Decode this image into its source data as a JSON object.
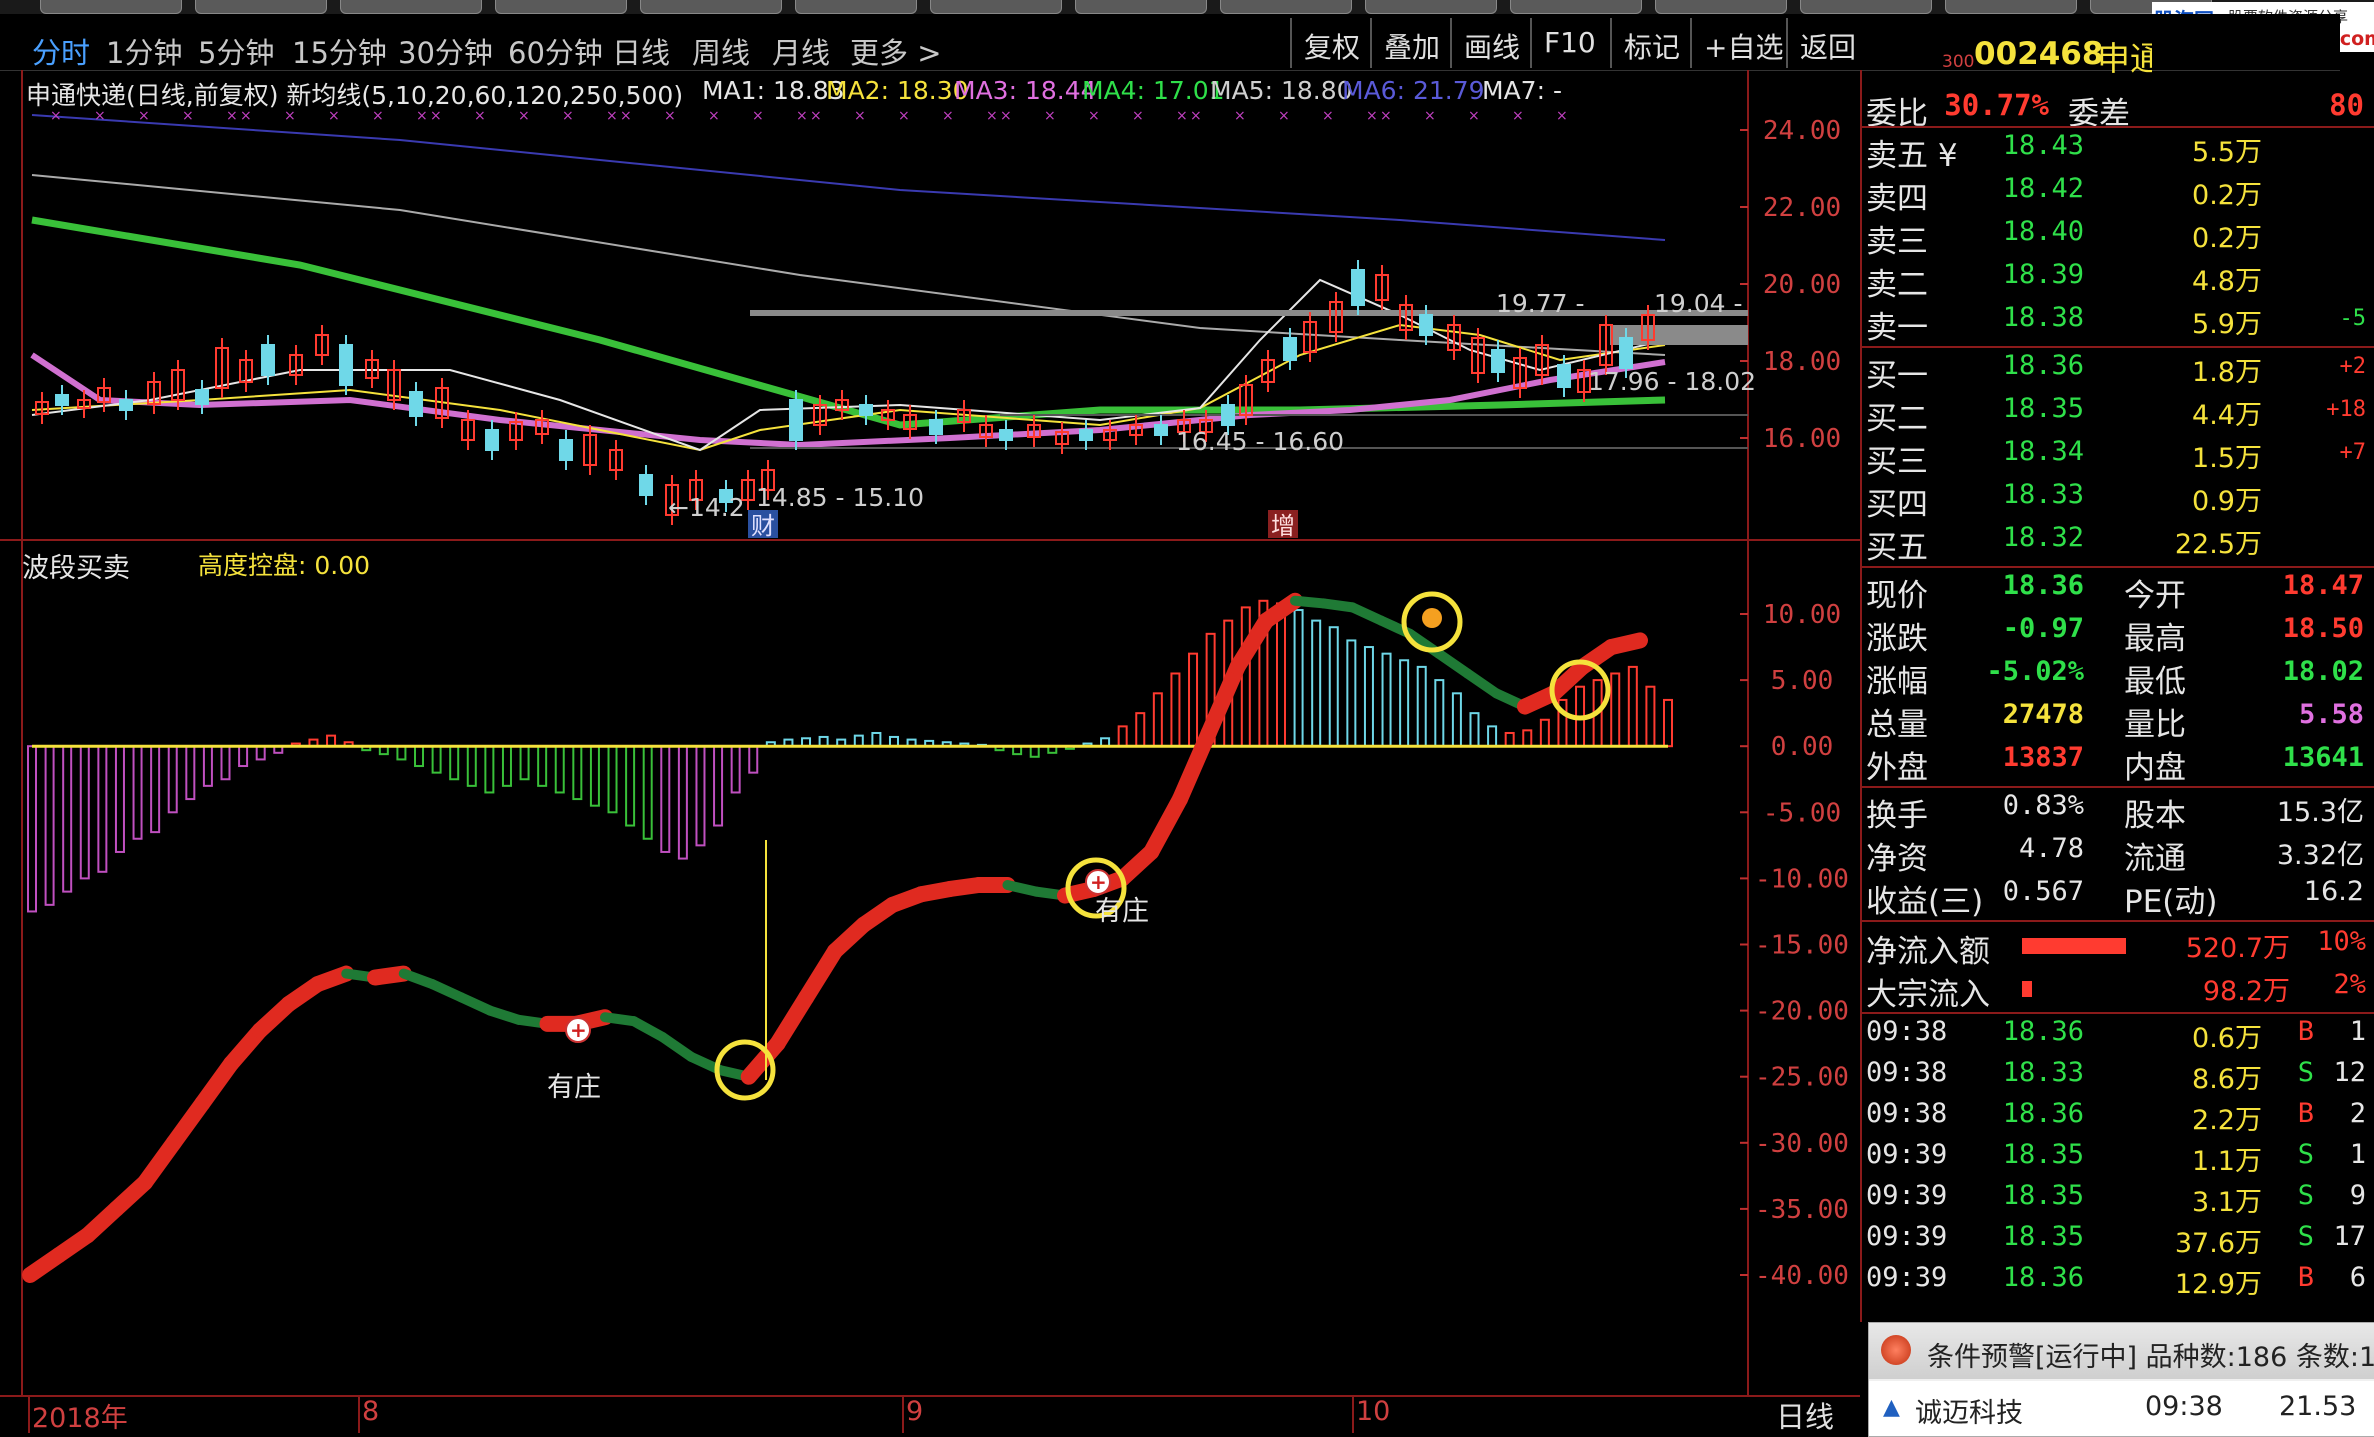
{
  "period_bar": {
    "items": [
      "分时",
      "1分钟",
      "5分钟",
      "15分钟",
      "30分钟",
      "60分钟",
      "日线",
      "周线",
      "月线",
      "更多 >"
    ],
    "active_index": 0,
    "tools": [
      "复权",
      "叠加",
      "画线",
      "F10",
      "标记",
      "+自选",
      "返回"
    ]
  },
  "watermark": {
    "site": "股海网",
    "slogan": "股票软件资源分享",
    "url": "www.Guhai.com.cn"
  },
  "stock": {
    "prefix": "300",
    "code": "002468",
    "name": "申通快递"
  },
  "main_chart": {
    "title": "申通快递(日线,前复权) 新均线(5,10,20,60,120,250,500)",
    "ma": [
      {
        "label": "MA1: 18.83",
        "color": "#e6e6e6"
      },
      {
        "label": "MA2: 18.30",
        "color": "#f5e23c"
      },
      {
        "label": "MA3: 18.44",
        "color": "#e070e0"
      },
      {
        "label": "MA4: 17.01",
        "color": "#2fe04a"
      },
      {
        "label": "MA5: 18.80",
        "color": "#cfcfcf"
      },
      {
        "label": "MA6: 21.79",
        "color": "#5a5ad8"
      },
      {
        "label": "MA7: -",
        "color": "#e6e6e6"
      }
    ],
    "y_axis": [
      "24.00",
      "22.00",
      "20.00",
      "18.00",
      "16.00"
    ],
    "annotations": {
      "high_range": "19.77 -",
      "high_right": "19.04 -",
      "low_right": "17.96 - 18.02",
      "mid_range": "16.45 - 16.60",
      "low_label": "←14.2",
      "low_range": "14.85 - 15.10",
      "badge_cai": "财",
      "badge_zeng": "增"
    }
  },
  "sub_chart": {
    "title": "波段买卖",
    "control_label": "高度控盘: 0.00",
    "y_axis": [
      "10.00",
      "5.00",
      "0.00",
      "-5.00",
      "-10.00",
      "-15.00",
      "-20.00",
      "-25.00",
      "-30.00",
      "-35.00",
      "-40.00"
    ],
    "labels": [
      "有庄",
      "有庄"
    ]
  },
  "chart_data": {
    "type": "bar",
    "title": "波段买卖",
    "ylim": [
      -42,
      12
    ],
    "values": [
      -12.5,
      -12,
      -11,
      -10,
      -9.5,
      -8,
      -7,
      -6.5,
      -5,
      -4,
      -3,
      -2.5,
      -1.5,
      -1,
      -0.5,
      0.2,
      0.5,
      0.8,
      0.3,
      -0.3,
      -0.6,
      -1,
      -1.5,
      -2,
      -2.5,
      -3,
      -3.5,
      -3,
      -2.5,
      -3,
      -3.5,
      -4,
      -4.5,
      -5,
      -6,
      -7,
      -8,
      -8.5,
      -7.5,
      -6,
      -3.5,
      -2,
      0.3,
      0.5,
      0.6,
      0.7,
      0.5,
      0.8,
      1,
      0.7,
      0.5,
      0.4,
      0.3,
      0.2,
      0.1,
      -0.3,
      -0.6,
      -0.8,
      -0.5,
      -0.2,
      0.2,
      0.6,
      1.5,
      2.5,
      4,
      5.5,
      7,
      8.5,
      9.5,
      10.5,
      11,
      10.8,
      10.3,
      9.5,
      9,
      8,
      7.5,
      7,
      6.5,
      6,
      5,
      4,
      2.5,
      1.5,
      1,
      1.2,
      2,
      3.5,
      4.5,
      5,
      5.5,
      6,
      4.5,
      3.5
    ],
    "wave_line": [
      -40,
      -38.5,
      -37,
      -35,
      -33,
      -30,
      -27,
      -24,
      -21.5,
      -19.5,
      -18,
      -17.2,
      -17.5,
      -17.2,
      -18,
      -19,
      -20,
      -20.7,
      -21,
      -21,
      -20.5,
      -20.8,
      -22,
      -23.5,
      -24.5,
      -25,
      -22.5,
      -19,
      -15.5,
      -13.5,
      -12,
      -11.2,
      -10.8,
      -10.5,
      -10.5,
      -11,
      -11.3,
      -10.8,
      -10,
      -8,
      -4,
      1,
      6,
      9.5,
      11,
      10.8,
      10.5,
      9.5,
      8.5,
      7,
      5.5,
      4,
      3,
      4,
      6,
      7.5,
      8
    ]
  },
  "quote": {
    "weibi": {
      "label": "委比",
      "value": "30.77%",
      "label2": "委差",
      "value2": "80"
    },
    "sell": [
      {
        "label": "卖五 ¥",
        "price": "18.43",
        "vol": "5.5万",
        "chg": ""
      },
      {
        "label": "卖四",
        "price": "18.42",
        "vol": "0.2万",
        "chg": ""
      },
      {
        "label": "卖三",
        "price": "18.40",
        "vol": "0.2万",
        "chg": ""
      },
      {
        "label": "卖二",
        "price": "18.39",
        "vol": "4.8万",
        "chg": ""
      },
      {
        "label": "卖一",
        "price": "18.38",
        "vol": "5.9万",
        "chg": "-5"
      }
    ],
    "buy": [
      {
        "label": "买一",
        "price": "18.36",
        "vol": "1.8万",
        "chg": "+2"
      },
      {
        "label": "买二",
        "price": "18.35",
        "vol": "4.4万",
        "chg": "+18"
      },
      {
        "label": "买三",
        "price": "18.34",
        "vol": "1.5万",
        "chg": "+7"
      },
      {
        "label": "买四",
        "price": "18.33",
        "vol": "0.9万",
        "chg": ""
      },
      {
        "label": "买五",
        "price": "18.32",
        "vol": "22.5万",
        "chg": ""
      }
    ],
    "stats1": [
      {
        "l1": "现价",
        "v1": "18.36",
        "c1": "green",
        "l2": "今开",
        "v2": "18.47",
        "c2": "red"
      },
      {
        "l1": "涨跌",
        "v1": "-0.97",
        "c1": "green",
        "l2": "最高",
        "v2": "18.50",
        "c2": "red"
      },
      {
        "l1": "涨幅",
        "v1": "-5.02%",
        "c1": "green",
        "l2": "最低",
        "v2": "18.02",
        "c2": "green"
      },
      {
        "l1": "总量",
        "v1": "27478",
        "c1": "yellow",
        "l2": "量比",
        "v2": "5.58",
        "c2": "magenta"
      },
      {
        "l1": "外盘",
        "v1": "13837",
        "c1": "red",
        "l2": "内盘",
        "v2": "13641",
        "c2": "green"
      }
    ],
    "stats2": [
      {
        "l1": "换手",
        "v1": "0.83%",
        "l2": "股本",
        "v2": "15.3亿"
      },
      {
        "l1": "净资",
        "v1": "4.78",
        "l2": "流通",
        "v2": "3.32亿"
      },
      {
        "l1": "收益(三)",
        "v1": "0.567",
        "l2": "PE(动)",
        "v2": "16.2"
      }
    ],
    "flows": [
      {
        "label": "净流入额",
        "value": "520.7万",
        "pct": "10%",
        "bar": 0.4
      },
      {
        "label": "大宗流入",
        "value": "98.2万",
        "pct": "2%",
        "bar": 0.04
      }
    ],
    "ticks": [
      {
        "time": "09:38",
        "price": "18.36",
        "vol": "0.6万",
        "side": "B",
        "n": "1"
      },
      {
        "time": "09:38",
        "price": "18.33",
        "vol": "8.6万",
        "side": "S",
        "n": "12"
      },
      {
        "time": "09:38",
        "price": "18.36",
        "vol": "2.2万",
        "side": "B",
        "n": "2"
      },
      {
        "time": "09:39",
        "price": "18.35",
        "vol": "1.1万",
        "side": "S",
        "n": "1"
      },
      {
        "time": "09:39",
        "price": "18.35",
        "vol": "3.1万",
        "side": "S",
        "n": "9"
      },
      {
        "time": "09:39",
        "price": "18.35",
        "vol": "37.6万",
        "side": "S",
        "n": "17"
      },
      {
        "time": "09:39",
        "price": "18.36",
        "vol": "12.9万",
        "side": "B",
        "n": "6"
      }
    ]
  },
  "alert": {
    "title": "条件预警[运行中] 品种数:186 条数:1",
    "row": {
      "name": "诚迈科技",
      "time": "09:38",
      "price": "21.53"
    }
  },
  "bottom": {
    "dates": [
      "2018年",
      "8",
      "9",
      "10"
    ],
    "mode": "日线"
  }
}
